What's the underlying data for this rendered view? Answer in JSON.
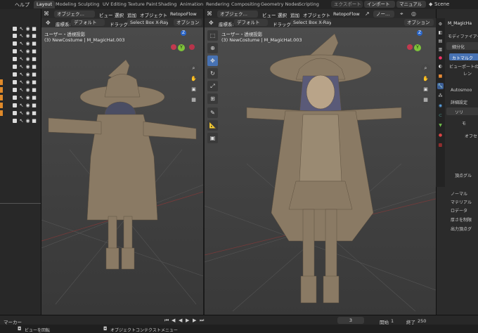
{
  "topbar": {
    "menu_help": "ヘルプ",
    "tabs": [
      "Layout",
      "Modeling",
      "Sculpting",
      "UV Editing",
      "Texture Paint",
      "Shading",
      "Animation",
      "Rendering",
      "Compositing",
      "Geometry Nodes",
      "Scripting"
    ],
    "export_label": "エクスポート",
    "import_label": "インポート",
    "manual_label": "マニュアル",
    "scene_label": "Scene"
  },
  "left_viewport": {
    "mode": "オブジェク…",
    "view": "ビュー",
    "select": "選択",
    "add": "追加",
    "object": "オブジェクト",
    "addon": "RetopoFlow",
    "coord_label": "座標系:",
    "coord_value": "デフォルト",
    "drag_label": "ドラッグ:",
    "drag_value": "Select Box X-Ray",
    "options": "オプション",
    "view_name": "ユーザー・透視投影",
    "object_info": "(3) NewCostume | M_MagicHat.003",
    "axis_z": "Z",
    "axis_y": "Y"
  },
  "right_viewport": {
    "mode": "オブジェク…",
    "view": "ビュー",
    "select": "選択",
    "add": "追加",
    "object": "オブジェクト",
    "addon": "RetopoFlow",
    "shading": "ノー…",
    "coord_label": "座標系:",
    "coord_value": "デフォルト",
    "drag_label": "ドラッグ:",
    "drag_value": "Select Box X-Ray",
    "options": "オプション",
    "view_name": "ユーザー・透視投影",
    "object_info": "(3) NewCostume | M_MagicHat.003",
    "axis_z": "Z",
    "axis_y": "Y"
  },
  "properties": {
    "object_name": "M_MagicHa",
    "modifier_header": "モディファイアー",
    "subsurf_label": "細分化",
    "catmull": "カトマルク",
    "viewport_levels": "ビューポートの",
    "render_label": "レン",
    "autosmooth": "Autosmoo",
    "advanced": "詳細設定",
    "solidify": "ソリ",
    "mode_label": "モ",
    "offset_label": "オフセ",
    "vertex_group": "頂点グル",
    "normals": "ノーマル",
    "material": "マテリアル",
    "data": "ロデータ",
    "thickness": "厚さを制限",
    "output_vg": "出力頂点グ"
  },
  "timeline": {
    "marker": "マーカー",
    "current_frame": "3",
    "start": "開始",
    "start_value": "1",
    "end": "終了",
    "end_value": "250"
  },
  "statusbar": {
    "rotate_view": "ビューを回転",
    "context_menu": "オブジェクトコンテクストメニュー"
  }
}
